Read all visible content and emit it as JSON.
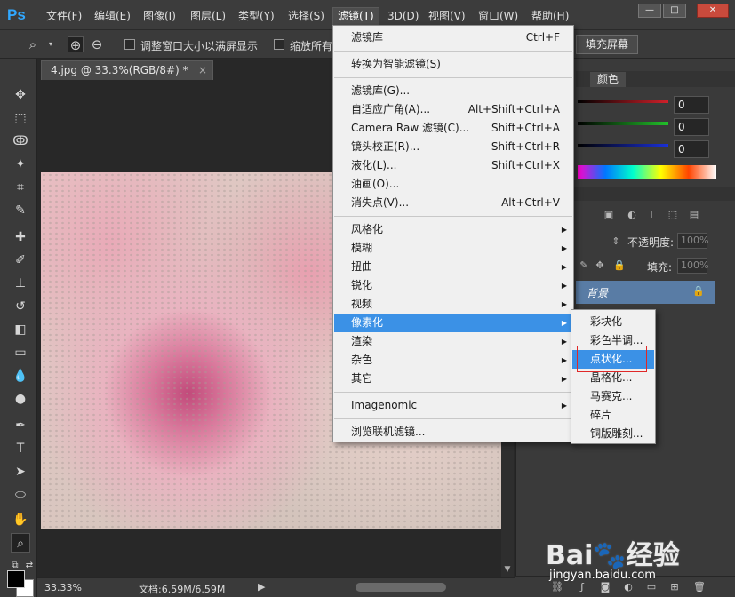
{
  "app": {
    "logo": "Ps"
  },
  "menubar": {
    "items": [
      "文件(F)",
      "编辑(E)",
      "图像(I)",
      "图层(L)",
      "类型(Y)",
      "选择(S)",
      "滤镜(T)",
      "3D(D)",
      "视图(V)",
      "窗口(W)",
      "帮助(H)"
    ],
    "active": "滤镜(T)"
  },
  "window_controls": {
    "minimize": "—",
    "maximize": "□",
    "close": "✕"
  },
  "options_bar": {
    "resize_windows_label": "调整窗口大小以满屏显示",
    "zoom_all_label": "缩放所有",
    "fill_screen_label": "填充屏幕"
  },
  "document": {
    "tab_title": "4.jpg @ 33.3%(RGB/8#) *",
    "tab_close": "×",
    "zoom": "33.33%",
    "doc_size": "文档:6.59M/6.59M"
  },
  "color_panel": {
    "tab_label": "颜色",
    "values": [
      "0",
      "0",
      "0"
    ],
    "colors": [
      "#d0202a",
      "#22c02a",
      "#1a30d8"
    ]
  },
  "layers_panel": {
    "opacity_label": "不透明度:",
    "opacity_value": "100%",
    "fill_label": "填充:",
    "fill_value": "100%",
    "layer_name": "背景",
    "lock_icon": "🔒"
  },
  "filter_menu": {
    "groups": [
      [
        {
          "label": "滤镜库",
          "shortcut": "Ctrl+F"
        }
      ],
      [
        {
          "label": "转换为智能滤镜(S)",
          "shortcut": ""
        }
      ],
      [
        {
          "label": "滤镜库(G)...",
          "shortcut": ""
        },
        {
          "label": "自适应广角(A)...",
          "shortcut": "Alt+Shift+Ctrl+A"
        },
        {
          "label": "Camera Raw 滤镜(C)...",
          "shortcut": "Shift+Ctrl+A"
        },
        {
          "label": "镜头校正(R)...",
          "shortcut": "Shift+Ctrl+R"
        },
        {
          "label": "液化(L)...",
          "shortcut": "Shift+Ctrl+X"
        },
        {
          "label": "油画(O)...",
          "shortcut": ""
        },
        {
          "label": "消失点(V)...",
          "shortcut": "Alt+Ctrl+V"
        }
      ],
      [
        {
          "label": "风格化",
          "submenu": true
        },
        {
          "label": "模糊",
          "submenu": true
        },
        {
          "label": "扭曲",
          "submenu": true
        },
        {
          "label": "锐化",
          "submenu": true
        },
        {
          "label": "视频",
          "submenu": true
        },
        {
          "label": "像素化",
          "submenu": true,
          "highlighted": true
        },
        {
          "label": "渲染",
          "submenu": true
        },
        {
          "label": "杂色",
          "submenu": true
        },
        {
          "label": "其它",
          "submenu": true
        }
      ],
      [
        {
          "label": "Imagenomic",
          "submenu": true
        }
      ],
      [
        {
          "label": "浏览联机滤镜...",
          "shortcut": ""
        }
      ]
    ]
  },
  "pixelate_submenu": {
    "items": [
      "彩块化",
      "彩色半调...",
      "点状化...",
      "晶格化...",
      "马赛克...",
      "碎片",
      "铜版雕刻..."
    ],
    "highlighted": "点状化..."
  },
  "watermark": {
    "logo": "Bai🐾经验",
    "url": "jingyan.baidu.com"
  }
}
